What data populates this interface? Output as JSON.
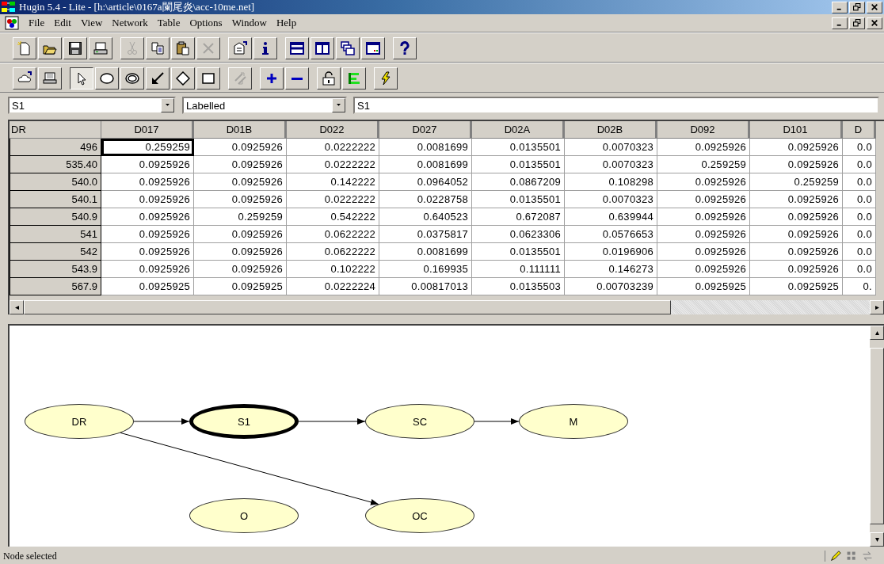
{
  "window": {
    "title": "Hugin 5.4 - Lite - [h:\\article\\0167a闌尾炎\\acc-10me.net]"
  },
  "menu": [
    "File",
    "Edit",
    "View",
    "Network",
    "Table",
    "Options",
    "Window",
    "Help"
  ],
  "toolbars": [
    [
      [
        {
          "kind": "new",
          "disabled": false
        },
        {
          "kind": "open",
          "disabled": false
        },
        {
          "kind": "save",
          "disabled": false
        },
        {
          "kind": "print",
          "disabled": false
        }
      ],
      [
        {
          "kind": "cut",
          "disabled": true
        },
        {
          "kind": "copy",
          "disabled": false
        },
        {
          "kind": "paste",
          "disabled": false
        },
        {
          "kind": "delete",
          "disabled": true
        }
      ],
      [
        {
          "kind": "properties",
          "disabled": false
        },
        {
          "kind": "info",
          "disabled": false
        }
      ],
      [
        {
          "kind": "tile-h",
          "disabled": false
        },
        {
          "kind": "tile-v",
          "disabled": false
        },
        {
          "kind": "cascade",
          "disabled": false
        },
        {
          "kind": "window",
          "disabled": false
        }
      ],
      [
        {
          "kind": "help",
          "disabled": false
        }
      ]
    ],
    [
      [
        {
          "kind": "network",
          "disabled": false
        },
        {
          "kind": "laptop",
          "disabled": false
        }
      ],
      [
        {
          "kind": "pointer",
          "disabled": false,
          "selected": true
        },
        {
          "kind": "ellipse",
          "disabled": false,
          "selected": false
        },
        {
          "kind": "double-ellipse",
          "disabled": false,
          "selected": false
        },
        {
          "kind": "link-arrow",
          "disabled": false,
          "selected": false
        },
        {
          "kind": "diamond",
          "disabled": false,
          "selected": false
        },
        {
          "kind": "rectangle",
          "disabled": false,
          "selected": false
        }
      ],
      [
        {
          "kind": "switch",
          "disabled": true
        }
      ],
      [
        {
          "kind": "plus",
          "disabled": false
        },
        {
          "kind": "minus",
          "disabled": false
        }
      ],
      [
        {
          "kind": "lock",
          "disabled": false
        },
        {
          "kind": "bars",
          "disabled": false
        }
      ],
      [
        {
          "kind": "lightning",
          "disabled": false
        }
      ]
    ]
  ],
  "node_selector": {
    "value": "S1"
  },
  "view_selector": {
    "value": "Labelled"
  },
  "label_field": {
    "value": "S1"
  },
  "table": {
    "corner": "DR",
    "columns": [
      "D017",
      "D01B",
      "D022",
      "D027",
      "D02A",
      "D02B",
      "D092",
      "D101",
      "D"
    ],
    "rows": [
      {
        "label": "496",
        "cells": [
          {
            "value": "0.259259",
            "focused": true
          },
          "0.0925926",
          "0.0222222",
          "0.0081699",
          "0.0135501",
          "0.0070323",
          "0.0925926",
          "0.0925926",
          "0.0"
        ]
      },
      {
        "label": "535.40",
        "cells": [
          "0.0925926",
          "0.0925926",
          "0.0222222",
          "0.0081699",
          "0.0135501",
          "0.0070323",
          "0.259259",
          "0.0925926",
          "0.0"
        ]
      },
      {
        "label": "540.0",
        "cells": [
          "0.0925926",
          "0.0925926",
          "0.142222",
          "0.0964052",
          "0.0867209",
          "0.108298",
          "0.0925926",
          "0.259259",
          "0.0"
        ]
      },
      {
        "label": "540.1",
        "cells": [
          "0.0925926",
          "0.0925926",
          "0.0222222",
          "0.0228758",
          "0.0135501",
          "0.0070323",
          "0.0925926",
          "0.0925926",
          "0.0"
        ]
      },
      {
        "label": "540.9",
        "cells": [
          "0.0925926",
          "0.259259",
          "0.542222",
          "0.640523",
          "0.672087",
          "0.639944",
          "0.0925926",
          "0.0925926",
          "0.0"
        ]
      },
      {
        "label": "541",
        "cells": [
          "0.0925926",
          "0.0925926",
          "0.0622222",
          "0.0375817",
          "0.0623306",
          "0.0576653",
          "0.0925926",
          "0.0925926",
          "0.0"
        ]
      },
      {
        "label": "542",
        "cells": [
          "0.0925926",
          "0.0925926",
          "0.0622222",
          "0.0081699",
          "0.0135501",
          "0.0196906",
          "0.0925926",
          "0.0925926",
          "0.0"
        ]
      },
      {
        "label": "543.9",
        "cells": [
          "0.0925926",
          "0.0925926",
          "0.102222",
          "0.169935",
          "0.111111",
          "0.146273",
          "0.0925926",
          "0.0925926",
          "0.0"
        ]
      },
      {
        "label": "567.9",
        "cells": [
          "0.0925925",
          "0.0925925",
          "0.0222224",
          "0.00817013",
          "0.0135503",
          "0.00703239",
          "0.0925925",
          "0.0925925",
          "0."
        ]
      }
    ]
  },
  "diagram": {
    "nodes": [
      {
        "label": "DR",
        "selected": false
      },
      {
        "label": "S1",
        "selected": true
      },
      {
        "label": "SC",
        "selected": false
      },
      {
        "label": "M",
        "selected": false
      },
      {
        "label": "O",
        "selected": false
      },
      {
        "label": "OC",
        "selected": false
      }
    ]
  },
  "status_bar": {
    "message": "Node selected"
  }
}
